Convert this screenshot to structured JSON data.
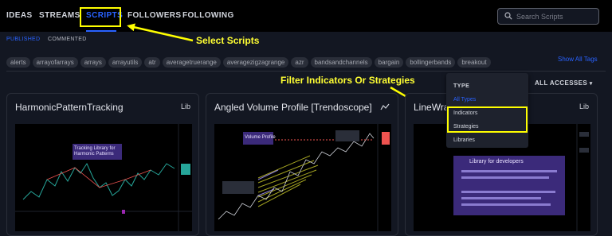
{
  "nav": {
    "items": [
      {
        "label": "IDEAS"
      },
      {
        "label": "STREAMS"
      },
      {
        "label": "SCRIPTS"
      },
      {
        "label": "FOLLOWERS"
      },
      {
        "label": "FOLLOWING"
      }
    ],
    "active": "SCRIPTS"
  },
  "search": {
    "placeholder": "Search Scripts",
    "value": "",
    "icon": "search-icon"
  },
  "subtabs": {
    "items": [
      {
        "label": "PUBLISHED"
      },
      {
        "label": "COMMENTED"
      }
    ],
    "active": "PUBLISHED"
  },
  "tags": [
    "alerts",
    "arrayofarrays",
    "arrays",
    "arrayutils",
    "atr",
    "averagetruerange",
    "averagezigzagrange",
    "azr",
    "bandsandchannels",
    "bargain",
    "bollingerbands",
    "breakout"
  ],
  "show_all_tags": "Show All Tags",
  "annotations": {
    "select_scripts": "Select Scripts",
    "filter": "Filter Indicators Or Strategies"
  },
  "filter": {
    "type_heading": "TYPE",
    "options": [
      {
        "label": "All Types"
      },
      {
        "label": "Indicators"
      },
      {
        "label": "Strategies"
      },
      {
        "label": "Libraries"
      }
    ],
    "selected": "All Types",
    "access_label": "ALL ACCESSES",
    "access_icon": "chevron-down-icon"
  },
  "cards": [
    {
      "title": "HarmonicPatternTracking",
      "type_label": "Lib",
      "chart_caption": "Tracking Library for Harmonic Patterns"
    },
    {
      "title": "Angled Volume Profile [Trendoscope]",
      "type_icon": "indicator-icon",
      "chart_caption": "Volume Profile"
    },
    {
      "title": "LineWra",
      "type_label": "Lib",
      "chart_caption": "Library for developers"
    }
  ],
  "colors": {
    "accent": "#2962ff",
    "annotation": "#ffff00",
    "background": "#131722",
    "topbar": "#000000"
  }
}
